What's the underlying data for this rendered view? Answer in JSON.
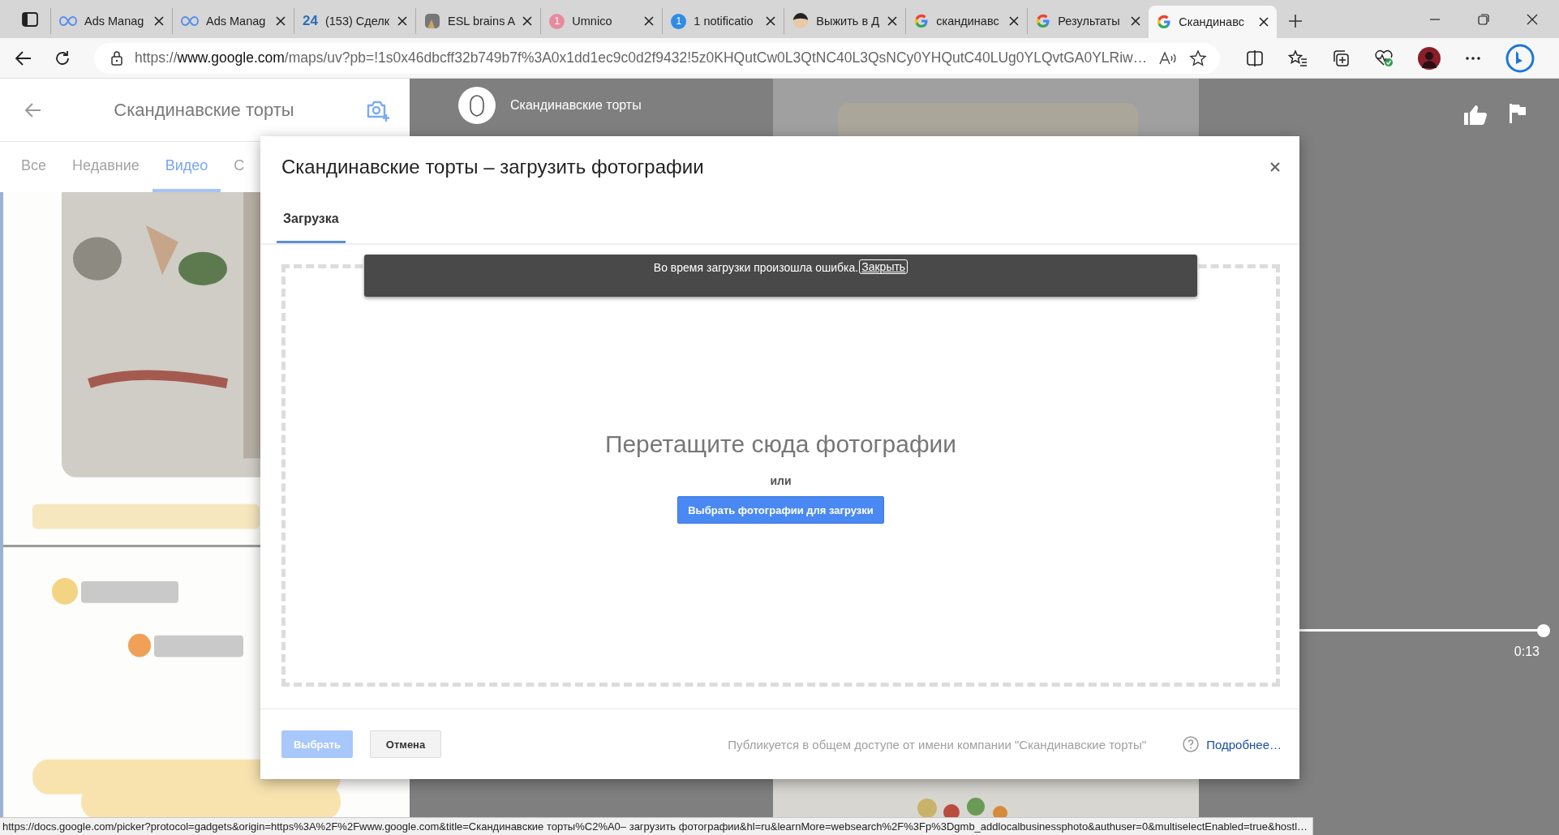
{
  "browser": {
    "tabs": [
      {
        "title": "Ads Manag",
        "favicon": {
          "kind": "meta"
        },
        "selected": false
      },
      {
        "title": "Ads Manag",
        "favicon": {
          "kind": "meta"
        },
        "selected": false
      },
      {
        "title": "(153) Сделк",
        "favicon": {
          "kind": "number",
          "text": "24"
        },
        "selected": false
      },
      {
        "title": "ESL brains A",
        "selected": false
      },
      {
        "title": "Umnico",
        "favicon": {
          "kind": "badge",
          "text": "1",
          "color": "#e88a9e"
        },
        "selected": false
      },
      {
        "title": "1 notificatio",
        "favicon": {
          "kind": "badge",
          "text": "1",
          "color": "#2f8be6"
        },
        "selected": false
      },
      {
        "title": "Выжить в Д",
        "favicon": {
          "kind": "avatar"
        },
        "selected": false
      },
      {
        "title": "скандинавс",
        "favicon": {
          "kind": "google"
        },
        "selected": false
      },
      {
        "title": "Результаты",
        "favicon": {
          "kind": "google"
        },
        "selected": false
      },
      {
        "title": "Скандинавс",
        "favicon": {
          "kind": "google"
        },
        "selected": true
      }
    ],
    "address": {
      "scheme": "https://",
      "host": "www.google.com",
      "path": "/maps/uv?pb=!1s0x46dbcff32b749b7f%3A0x1dd1ec9c0d2f9432!5z0KHQutCw0L3QtNC40L3QsNCy0YHQutC40LUg0YLQvtGA0YLRiw…"
    }
  },
  "side_panel": {
    "title": "Скандинавские торты",
    "tabs": [
      {
        "label": "Все",
        "selected": false
      },
      {
        "label": "Недавние",
        "selected": false
      },
      {
        "label": "Видео",
        "selected": true
      },
      {
        "label": "С",
        "selected": false
      }
    ]
  },
  "viewer": {
    "author": "Скандинавские торты",
    "progress": {
      "level": 1
    },
    "time": "0:13"
  },
  "dialog": {
    "title": "Скандинавские торты – загрузить фотографии",
    "tabs": [
      {
        "label": "Загрузка",
        "selected": true
      }
    ],
    "error": {
      "message": "Во время загрузки произошла ошибка.",
      "action": "Закрыть"
    },
    "drop_hint": "Перетащите сюда фотографии",
    "or": "или",
    "choose_button": "Выбрать фотографии для загрузки",
    "footer": {
      "select_button": {
        "label": "Выбрать",
        "disabled": true
      },
      "cancel_button": "Отмена",
      "note": "Публикуется в общем доступе от имени компании \"Скандинавские торты\"",
      "help_link": "Подробнее…"
    }
  },
  "status_bar": "https://docs.google.com/picker?protocol=gadgets&origin=https%3A%2F%2Fwww.google.com&title=Скандинавские торты%C2%A0– загрузить фотографии&hl=ru&learnMore=websearch%2F%3Fp%3Dgmb_addlocalbusinessphoto&authuser=0&multiselectEnabled=true&hostl…"
}
